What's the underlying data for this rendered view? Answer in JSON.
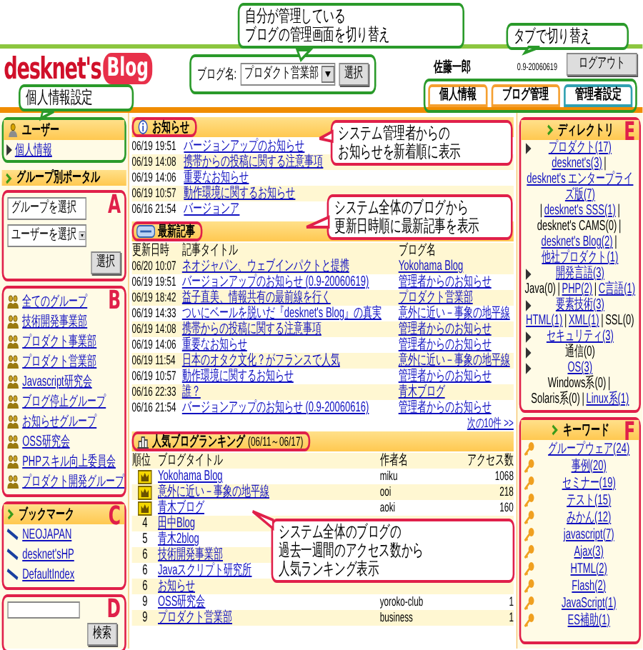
{
  "logo": {
    "name": "desknet's",
    "product": "Blog"
  },
  "blog_selector": {
    "label": "ブログ名:",
    "value": "プロダクト営業部",
    "button": "選択"
  },
  "user": {
    "name": "佐藤一郎",
    "version": "0.9-20060619",
    "logout": "ログアウト"
  },
  "tabs": [
    {
      "label": "個人情報",
      "selected": false
    },
    {
      "label": "ブログ管理",
      "selected": false
    },
    {
      "label": "管理者設定",
      "selected": true
    }
  ],
  "user_panel": {
    "title": "ユーザー",
    "items": [
      "個人情報"
    ]
  },
  "group_portal": {
    "title": "グループ別ポータル",
    "marker": "A",
    "group_select": "グループを選択",
    "user_select": "ユーザーを選択",
    "button": "選択"
  },
  "groups": {
    "marker": "B",
    "items": [
      "全てのグループ",
      "技術開発事業部",
      "プロダクト事業部",
      "プロダクト営業部",
      "Javascript研究会",
      "ブログ停止グループ",
      "お知らせグループ",
      "OSS研究会",
      "PHPスキル向上委員会",
      "プロダクト開発グループ"
    ]
  },
  "bookmarks": {
    "title": "ブックマーク",
    "marker": "C",
    "items": [
      "NEOJAPAN",
      "desknet'sHP",
      "DefaultIndex"
    ]
  },
  "search": {
    "marker": "D",
    "button": "検索"
  },
  "notices": {
    "title": "お知らせ",
    "rows": [
      {
        "date": "06/19 19:51",
        "title": "バージョンアップのお知らせ"
      },
      {
        "date": "06/19 14:08",
        "title": "携帯からの投稿に関する注意事項"
      },
      {
        "date": "06/19 14:06",
        "title": "重要なお知らせ"
      },
      {
        "date": "06/19 10:57",
        "title": "動作環境に関するお知らせ"
      },
      {
        "date": "06/16 21:54",
        "title": "バージョンア"
      }
    ]
  },
  "latest_posts": {
    "title": "最新記事",
    "columns": [
      "更新日時",
      "記事タイトル",
      "ブログ名"
    ],
    "rows": [
      {
        "date": "06/20 10:07",
        "title": "ネオジャパン、ウェブインパクトと提携",
        "blog": "Yokohama Blog"
      },
      {
        "date": "06/19 19:51",
        "title": "バージョンアップのお知らせ (0.9-20060619)",
        "blog": "管理者からのお知らせ"
      },
      {
        "date": "06/19 18:42",
        "title": "益子直美、情報共有の最前線を行く",
        "blog": "プロダクト営業部"
      },
      {
        "date": "06/19 14:33",
        "title": "ついにベールを脱いだ『desknet's Blog』の真実",
        "blog": "意外に近い－事象の地平線"
      },
      {
        "date": "06/19 14:08",
        "title": "携帯からの投稿に関する注意事項",
        "blog": "管理者からのお知らせ"
      },
      {
        "date": "06/19 14:06",
        "title": "重要なお知らせ",
        "blog": "管理者からのお知らせ"
      },
      {
        "date": "06/19 11:54",
        "title": "日本のオタク文化？がフランスで人気",
        "blog": "意外に近い－事象の地平線"
      },
      {
        "date": "06/19 10:57",
        "title": "動作環境に関するお知らせ",
        "blog": "管理者からのお知らせ"
      },
      {
        "date": "06/16 22:33",
        "title": "誰？",
        "blog": "青木ブログ"
      },
      {
        "date": "06/16 21:54",
        "title": "バージョンアップのお知らせ (0.9-20060616)",
        "blog": "管理者からのお知らせ"
      }
    ],
    "next_link": "次の10件 >>"
  },
  "ranking": {
    "title": "人気ブログランキング",
    "period": "(06/11～06/17)",
    "columns": [
      "順位",
      "ブログタイトル",
      "作者名",
      "アクセス数"
    ],
    "rows": [
      {
        "kind": "medal",
        "title": "Yokohama Blog",
        "author": "miku",
        "access": "1068"
      },
      {
        "kind": "medal",
        "title": "意外に近い－事象の地平線",
        "author": "ooi",
        "access": "218"
      },
      {
        "kind": "medal",
        "title": "青木ブログ",
        "author": "aoki",
        "access": "160"
      },
      {
        "kind": "number",
        "rank": "4",
        "title": "田中Blog"
      },
      {
        "kind": "number",
        "rank": "5",
        "title": "青木2blog"
      },
      {
        "kind": "number",
        "rank": "6",
        "title": "技術開発事業部"
      },
      {
        "kind": "number",
        "rank": "6",
        "title": "Javaスクリプト研究所"
      },
      {
        "kind": "number",
        "rank": "6",
        "title": "お知らせ"
      },
      {
        "kind": "number",
        "rank": "9",
        "title": "OSS研究会",
        "author": "yoroko-club",
        "access": "1"
      },
      {
        "kind": "number",
        "rank": "9",
        "title": "プロダクト営業部",
        "author": "business",
        "access": "1"
      }
    ]
  },
  "directory": {
    "title": "ディレクトリ",
    "marker": "E",
    "separator": "|",
    "categories": [
      {
        "label": "プロダクト(17)",
        "link": true,
        "children": [
          {
            "label": "desknet's(3)",
            "link": true
          },
          {
            "label": "desknet's エンタープライズ版(7)",
            "link": true
          },
          {
            "label": "desknet's SSS(1)",
            "link": true
          },
          {
            "label": "desknet's CAMS(0)",
            "link": false
          },
          {
            "label": "desknet's Blog(2)",
            "link": true
          },
          {
            "label": "他社プロダクト(1)",
            "link": true
          }
        ]
      },
      {
        "label": "開発言語(3)",
        "link": true,
        "children": [
          {
            "label": "Java(0)",
            "link": false
          },
          {
            "label": "PHP(2)",
            "link": true
          },
          {
            "label": "C言語(1)",
            "link": true
          }
        ]
      },
      {
        "label": "要素技術(3)",
        "link": true,
        "children": [
          {
            "label": "HTML(1)",
            "link": true
          },
          {
            "label": "XML(1)",
            "link": true
          },
          {
            "label": "SSL(0)",
            "link": false
          }
        ]
      },
      {
        "label": "セキュリティ(3)",
        "link": true
      },
      {
        "label": "通信(0)",
        "link": false
      },
      {
        "label": "OS(3)",
        "link": true,
        "children": [
          {
            "label": "Windows系(0)",
            "link": false
          },
          {
            "label": "Solaris系(0)",
            "link": false
          },
          {
            "label": "Linux系(1)",
            "link": true
          }
        ]
      }
    ]
  },
  "keywords": {
    "title": "キーワード",
    "marker": "F",
    "items": [
      "グループウェア(24)",
      "事例(20)",
      "セミナー(19)",
      "テスト(15)",
      "みかん(12)",
      "javascript(7)",
      "Ajax(3)",
      "HTML(2)",
      "Flash(2)",
      "JavaScript(1)",
      "ES補助(1)"
    ]
  },
  "callouts": [
    {
      "kind": "hint",
      "lines": [
        "自分が管理している",
        "ブログの管理画面を切り替え"
      ]
    },
    {
      "kind": "hint",
      "lines": [
        "タブで切り替え"
      ]
    },
    {
      "kind": "hint",
      "lines": [
        "個人情報設定"
      ]
    },
    {
      "kind": "feature",
      "lines": [
        "システム管理者からの",
        "お知らせを新着順に表示"
      ]
    },
    {
      "kind": "feature",
      "lines": [
        "システム全体のブログから",
        "更新日時順に最新記事を表示"
      ]
    },
    {
      "kind": "feature",
      "lines": [
        "システム全体のブログの",
        "過去一週間のアクセス数から",
        "人気ランキング表示"
      ]
    }
  ]
}
